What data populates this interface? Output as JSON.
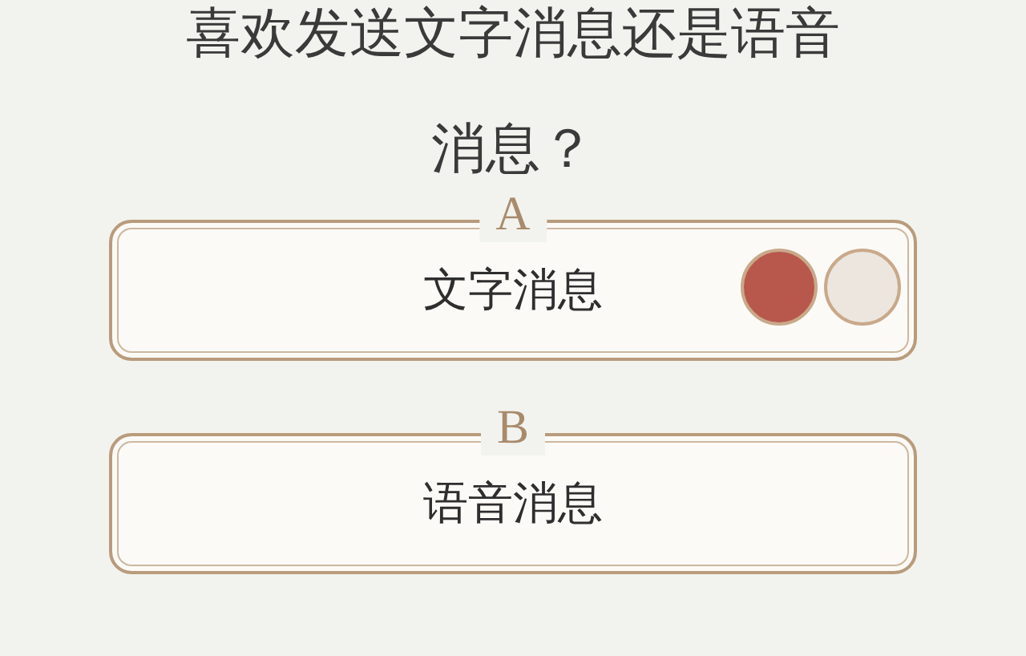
{
  "question": "喜欢发送文字消息还是语音消息？",
  "options": [
    {
      "letter": "A",
      "text": "文字消息",
      "avatars": [
        {
          "color": "#b8574c"
        },
        {
          "color": "#ece6df"
        }
      ]
    },
    {
      "letter": "B",
      "text": "语音消息"
    }
  ]
}
